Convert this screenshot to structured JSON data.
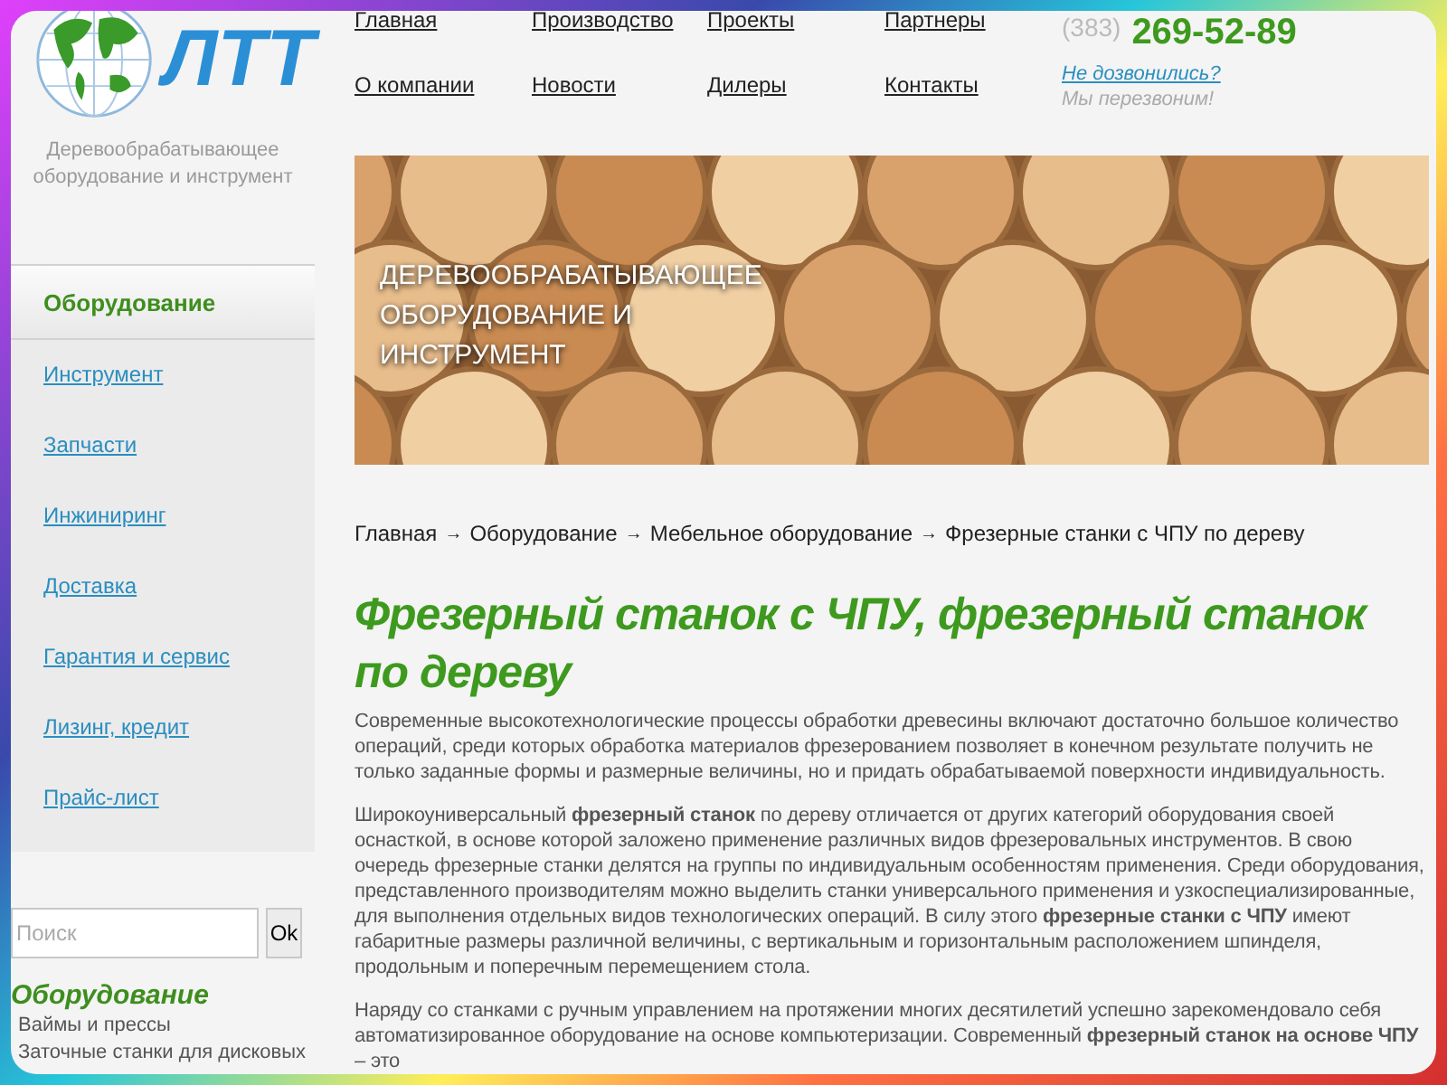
{
  "logo": {
    "text": "ЛТТ",
    "tagline": "Деревообрабатывающее оборудование и инструмент"
  },
  "top_nav": [
    {
      "label": "Главная"
    },
    {
      "label": "Производство"
    },
    {
      "label": "Проекты"
    },
    {
      "label": "Партнеры"
    },
    {
      "label": "О компании"
    },
    {
      "label": "Новости"
    },
    {
      "label": "Дилеры"
    },
    {
      "label": "Контакты"
    }
  ],
  "contact": {
    "code": "(383)",
    "phone": "269-52-89",
    "callback_link": "Не дозвонились?",
    "callback_note": "Мы перезвоним!"
  },
  "banner": {
    "caption": "ДЕРЕВООБРАБАТЫВАЮЩЕЕ ОБОРУДОВАНИЕ И ИНСТРУМЕНТ"
  },
  "side_menu": [
    {
      "label": "Оборудование",
      "selected": true
    },
    {
      "label": "Инструмент",
      "selected": false
    },
    {
      "label": "Запчасти",
      "selected": false
    },
    {
      "label": "Инжиниринг",
      "selected": false
    },
    {
      "label": "Доставка",
      "selected": false
    },
    {
      "label": "Гарантия и сервис",
      "selected": false
    },
    {
      "label": "Лизинг, кредит",
      "selected": false
    },
    {
      "label": "Прайс-лист",
      "selected": false
    }
  ],
  "search": {
    "placeholder": "Поиск",
    "button": "Ok"
  },
  "category": {
    "title": "Оборудование",
    "items": [
      "Ваймы и прессы",
      "Заточные станки для дисковых"
    ]
  },
  "breadcrumbs": [
    "Главная",
    "Оборудование",
    "Мебельное оборудование",
    "Фрезерные станки с ЧПУ по дереву"
  ],
  "breadcrumb_separator": "→",
  "heading": "Фрезерный станок с ЧПУ, фрезерный станок по дереву",
  "paragraphs": [
    "Современные высокотехнологические процессы обработки древесины включают достаточно большое количество операций, среди которых обработка материалов фрезерованием позволяет в конечном результате получить не только заданные формы и размерные величины, но и придать обрабатываемой поверхности индивидуальность.",
    "Широкоуниверсальный **фрезерный станок** по дереву отличается от других категорий оборудования своей оснасткой, в основе которой заложено применение различных видов фрезеровальных инструментов. В свою очередь фрезерные станки делятся на группы по индивидуальным особенностям применения. Среди оборудования, представленного производителям можно выделить станки универсального применения и узкоспециализированные, для выполнения отдельных видов технологических операций. В силу этого **фрезерные станки с ЧПУ** имеют габаритные размеры различной величины, с вертикальным и горизонтальным расположением шпинделя, продольным и поперечным перемещением стола.",
    "Наряду со станками с ручным управлением на протяжении многих десятилетий успешно зарекомендовало себя автоматизированное оборудование на основе компьютеризации. Современный **фрезерный станок на основе ЧПУ** – это"
  ]
}
